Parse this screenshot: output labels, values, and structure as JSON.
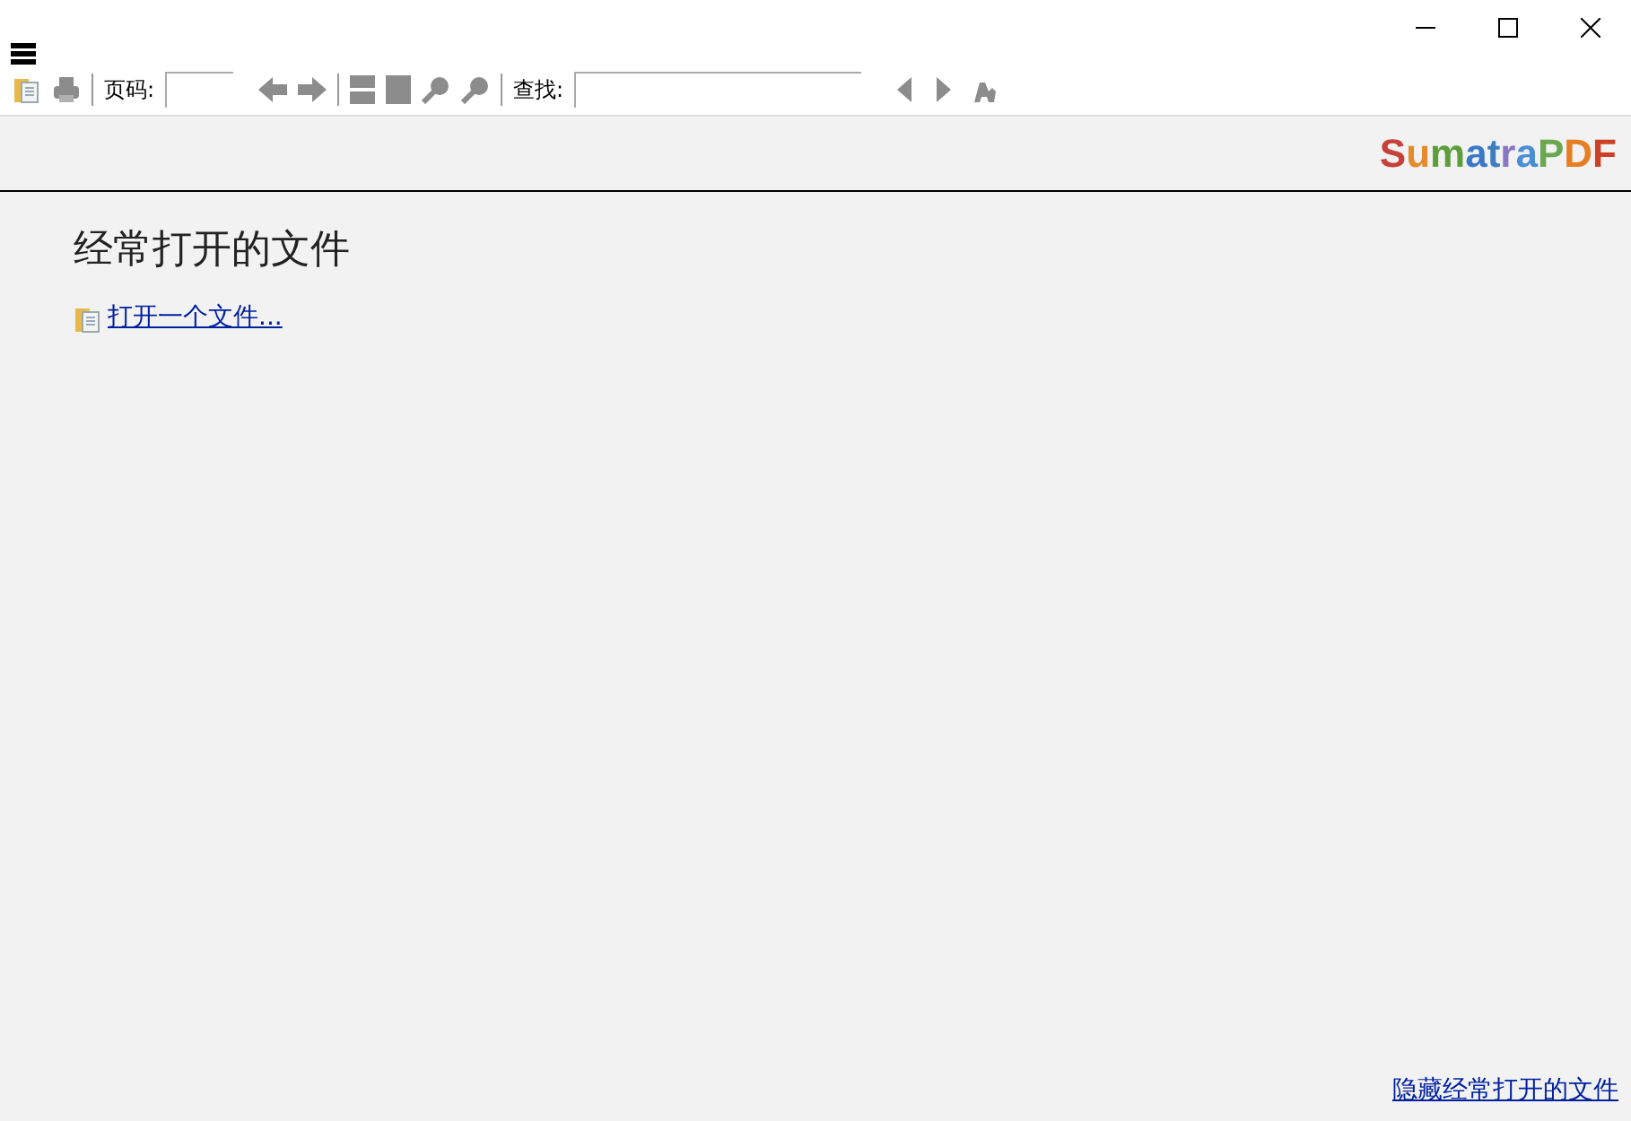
{
  "toolbar": {
    "page_label": "页码:",
    "find_label": "查找:"
  },
  "logo": "SumatraPDF",
  "frequent": {
    "title": "经常打开的文件",
    "open_link": "打开一个文件...",
    "hide_link": "隐藏经常打开的文件"
  }
}
